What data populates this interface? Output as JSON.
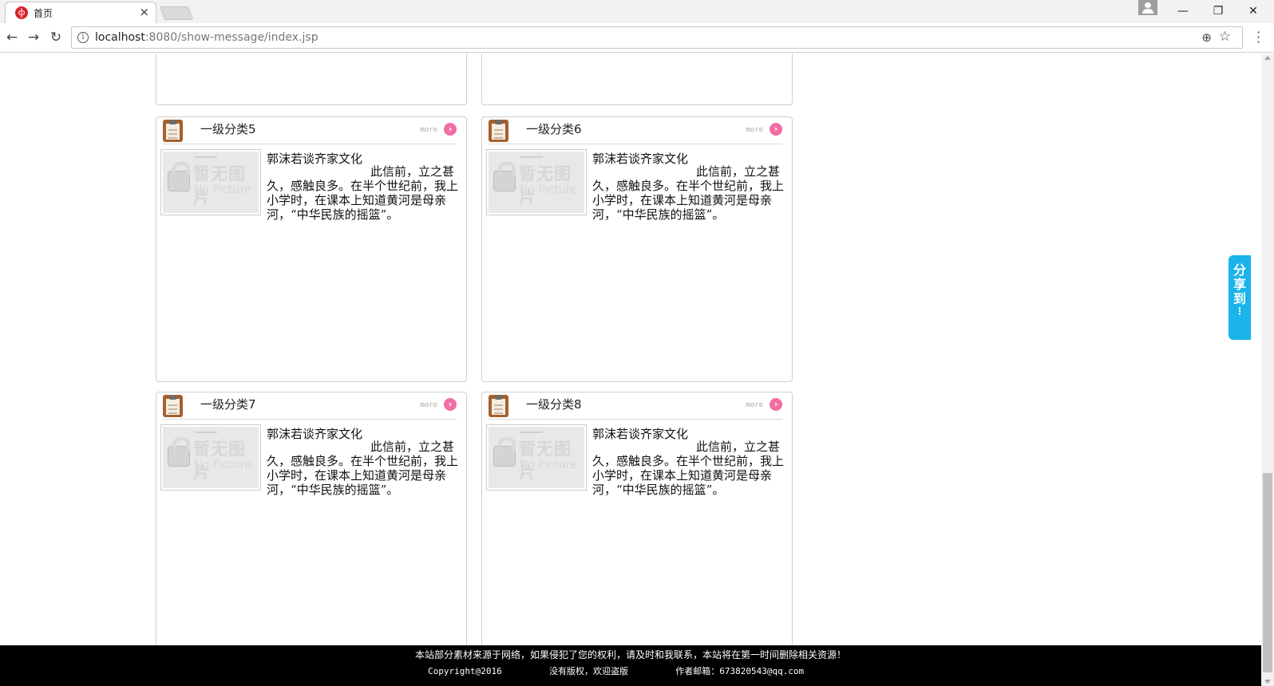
{
  "browser": {
    "tab_title": "首页",
    "url_host": "localhost",
    "url_rest": ":8080/show-message/index.jsp",
    "minimize": "—",
    "restore": "❐",
    "close": "✕"
  },
  "cards": [
    {
      "title": "一级分类5",
      "more": "more",
      "article_title": "郭沫若谈齐家文化",
      "article_excerpt": "此信前，立之甚久，感触良多。在半个世纪前，我上小学时，在课本上知道黄河是母亲河，“中华民族的摇篮”。",
      "thumb_cn": "暂无图片",
      "thumb_en": "No Picture"
    },
    {
      "title": "一级分类6",
      "more": "more",
      "article_title": "郭沫若谈齐家文化",
      "article_excerpt": "此信前，立之甚久，感触良多。在半个世纪前，我上小学时，在课本上知道黄河是母亲河，“中华民族的摇篮”。",
      "thumb_cn": "暂无图片",
      "thumb_en": "No Picture"
    },
    {
      "title": "一级分类7",
      "more": "more",
      "article_title": "郭沫若谈齐家文化",
      "article_excerpt": "此信前，立之甚久，感触良多。在半个世纪前，我上小学时，在课本上知道黄河是母亲河，“中华民族的摇篮”。",
      "thumb_cn": "暂无图片",
      "thumb_en": "No Picture"
    },
    {
      "title": "一级分类8",
      "more": "more",
      "article_title": "郭沫若谈齐家文化",
      "article_excerpt": "此信前，立之甚久，感触良多。在半个世纪前，我上小学时，在课本上知道黄河是母亲河，“中华民族的摇篮”。",
      "thumb_cn": "暂无图片",
      "thumb_en": "No Picture"
    }
  ],
  "share": {
    "chars": [
      "分",
      "享",
      "到"
    ],
    "dots": "⋮"
  },
  "footer": {
    "notice": "本站部分素材来源于网络，如果侵犯了您的权利，请及时和我联系，本站将在第一时间删除相关资源！",
    "copyright": "Copyright@2016",
    "no_rights": "没有版权，欢迎盗版",
    "email": "作者邮箱：673820543@qq.com"
  },
  "colors": {
    "share_bg": "#1ab3ea",
    "more_icon": "#f06ea4",
    "footer_bg": "#000000",
    "clipboard_icon": "#a5602d"
  }
}
